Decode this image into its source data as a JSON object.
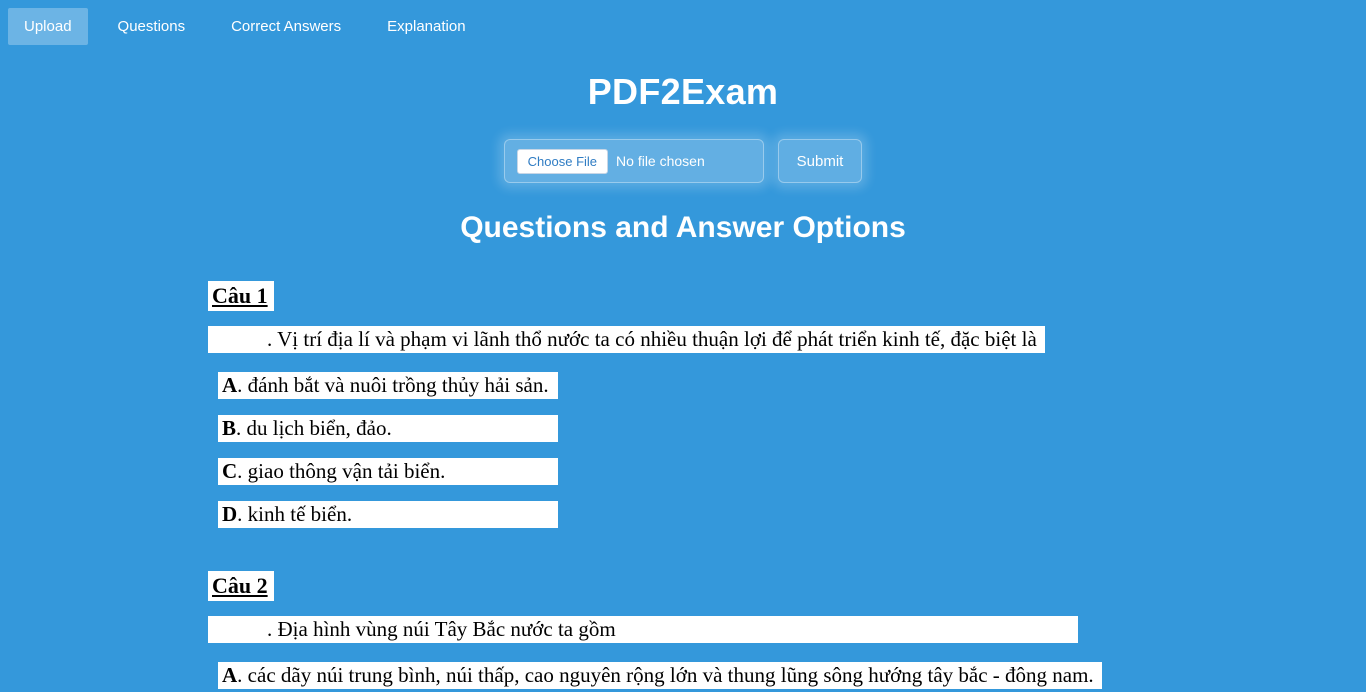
{
  "nav": {
    "items": [
      {
        "label": "Upload",
        "active": true
      },
      {
        "label": "Questions",
        "active": false
      },
      {
        "label": "Correct Answers",
        "active": false
      },
      {
        "label": "Explanation",
        "active": false
      }
    ]
  },
  "header": {
    "title": "PDF2Exam"
  },
  "upload": {
    "choose_label": "Choose File",
    "status": "No file chosen",
    "submit_label": "Submit"
  },
  "section": {
    "title": "Questions and Answer Options"
  },
  "questions": [
    {
      "header": "Câu 1",
      "prompt": ". Vị trí địa lí và phạm vi lãnh thổ nước ta có nhiều thuận lợi để phát triển kinh tế, đặc biệt là",
      "options": [
        {
          "letter": "A",
          "text": ". đánh bắt và nuôi trồng thủy hải sản."
        },
        {
          "letter": "B",
          "text": ". du lịch biển, đảo."
        },
        {
          "letter": "C",
          "text": ". giao thông vận tải biển."
        },
        {
          "letter": "D",
          "text": ". kinh tế biển."
        }
      ]
    },
    {
      "header": "Câu 2",
      "prompt": ". Địa hình vùng núi Tây Bắc nước ta gồm",
      "options": [
        {
          "letter": "A",
          "text": ". các dãy núi trung bình, núi thấp, cao nguyên rộng lớn và thung lũng sông hướng tây bắc - đông nam."
        }
      ]
    }
  ]
}
